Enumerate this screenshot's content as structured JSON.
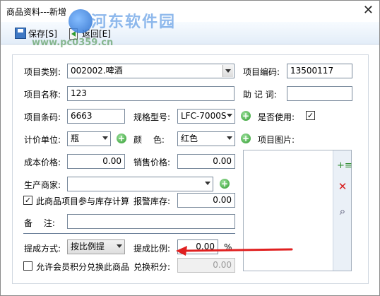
{
  "window": {
    "title": "商品资料---新增"
  },
  "watermark": {
    "site": "河东软件园",
    "url": "www.pc0359.cn"
  },
  "toolbar": {
    "save_label": "保存[S]",
    "back_label": "返回[E]"
  },
  "form": {
    "category": {
      "label": "项目类别:",
      "value": "002002.啤酒"
    },
    "code": {
      "label": "项目编码:",
      "value": "13500117"
    },
    "name": {
      "label": "项目名称:",
      "value": "123"
    },
    "mnemonic": {
      "label": "助 记 词:",
      "value": ""
    },
    "barcode": {
      "label": "项目条码:",
      "value": "6663"
    },
    "spec": {
      "label": "规格型号:",
      "value": "LFC-7000S"
    },
    "in_use": {
      "label": "是否使用:",
      "checked": true
    },
    "unit": {
      "label": "计价单位:",
      "value": "瓶"
    },
    "color": {
      "label": "颜　 色:",
      "value": "红色"
    },
    "image": {
      "label": "项目图片:"
    },
    "cost_price": {
      "label": "成本价格:",
      "value": "0.00"
    },
    "sale_price": {
      "label": "销售价格:",
      "value": "0.00"
    },
    "manufacturer": {
      "label": "生产商家:",
      "value": ""
    },
    "stock_calc": {
      "label": "此商品项目参与库存计算",
      "checked": true
    },
    "alarm_stock": {
      "label": "报警库存:",
      "value": "0.00"
    },
    "remark": {
      "label": "备　 注:",
      "value": ""
    },
    "commission_method": {
      "label": "提成方式:",
      "value": "按比例提"
    },
    "commission_rate": {
      "label": "提成比例:",
      "value": "0.00",
      "unit": "%"
    },
    "points_exchange": {
      "label": "允许会员积分兑换此商品",
      "checked": false
    },
    "exchange_points": {
      "label": "兑换积分:",
      "value": "0.00"
    }
  },
  "colors": {
    "annotation_arrow": "#e02020",
    "toolbar_bg": "#e3edf8",
    "add_icon": "#2e9a2e"
  },
  "icons": [
    "save-icon",
    "back-icon",
    "close-icon",
    "add-icon",
    "delete-icon",
    "zoom-icon",
    "check-icon"
  ]
}
